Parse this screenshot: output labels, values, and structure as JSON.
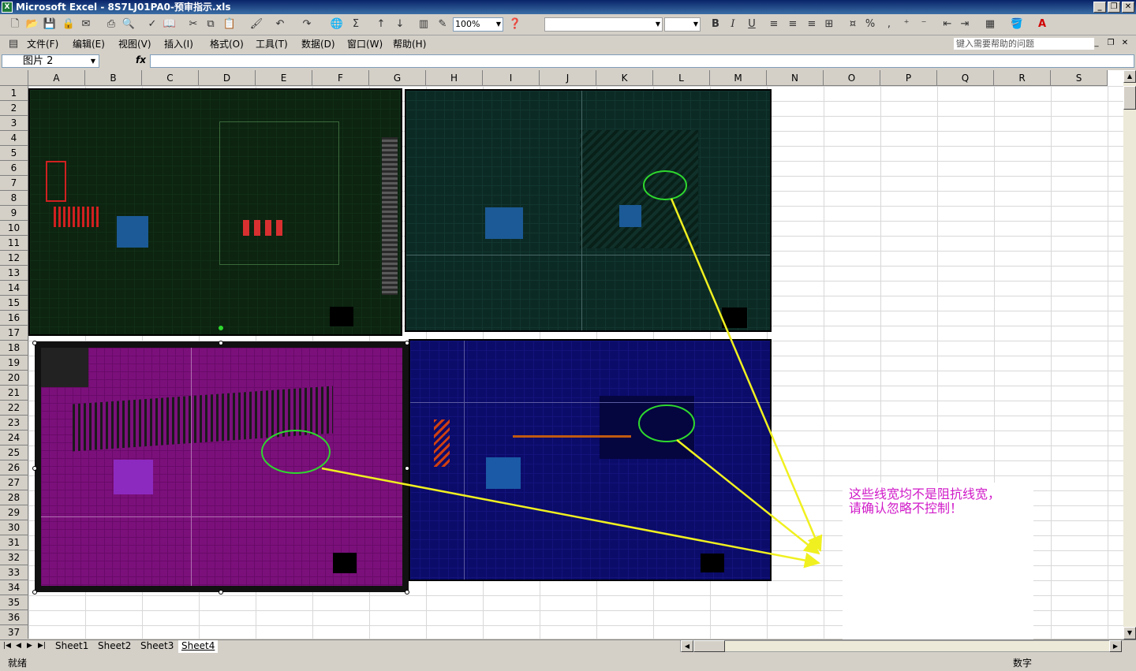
{
  "window": {
    "title": "Microsoft Excel - 8S7LJ01PA0-预审指示.xls"
  },
  "toolbar": {
    "zoom": "100%",
    "font_name": "",
    "font_size": ""
  },
  "menu": {
    "items": [
      "文件(F)",
      "编辑(E)",
      "视图(V)",
      "插入(I)",
      "格式(O)",
      "工具(T)",
      "数据(D)",
      "窗口(W)",
      "帮助(H)"
    ]
  },
  "help": {
    "placeholder": "键入需要帮助的问题"
  },
  "formula": {
    "namebox": "图片 2",
    "fx": "fx",
    "content": ""
  },
  "grid": {
    "columns": [
      "A",
      "B",
      "C",
      "D",
      "E",
      "F",
      "G",
      "H",
      "I",
      "J",
      "K",
      "L",
      "M",
      "N",
      "O",
      "P",
      "Q",
      "R",
      "S"
    ],
    "rows": [
      "1",
      "2",
      "3",
      "4",
      "5",
      "6",
      "7",
      "8",
      "9",
      "10",
      "11",
      "12",
      "13",
      "14",
      "15",
      "16",
      "17",
      "18",
      "19",
      "20",
      "21",
      "22",
      "23",
      "24",
      "25",
      "26",
      "27",
      "28",
      "29",
      "30",
      "31",
      "32",
      "33",
      "34",
      "35",
      "36",
      "37"
    ]
  },
  "sheets": {
    "tabs": [
      "Sheet1",
      "Sheet2",
      "Sheet3",
      "Sheet4"
    ],
    "active": "Sheet4"
  },
  "status": {
    "ready": "就绪",
    "mode": "数字"
  },
  "annotation": {
    "line1": "这些线宽均不是阻抗线宽，",
    "line2": "请确认忽略不控制！"
  },
  "colors": {
    "arrow": "#f0f020",
    "circle": "#2ed82e",
    "note_text": "#d01ac8",
    "title_bar": "#0a246a"
  }
}
